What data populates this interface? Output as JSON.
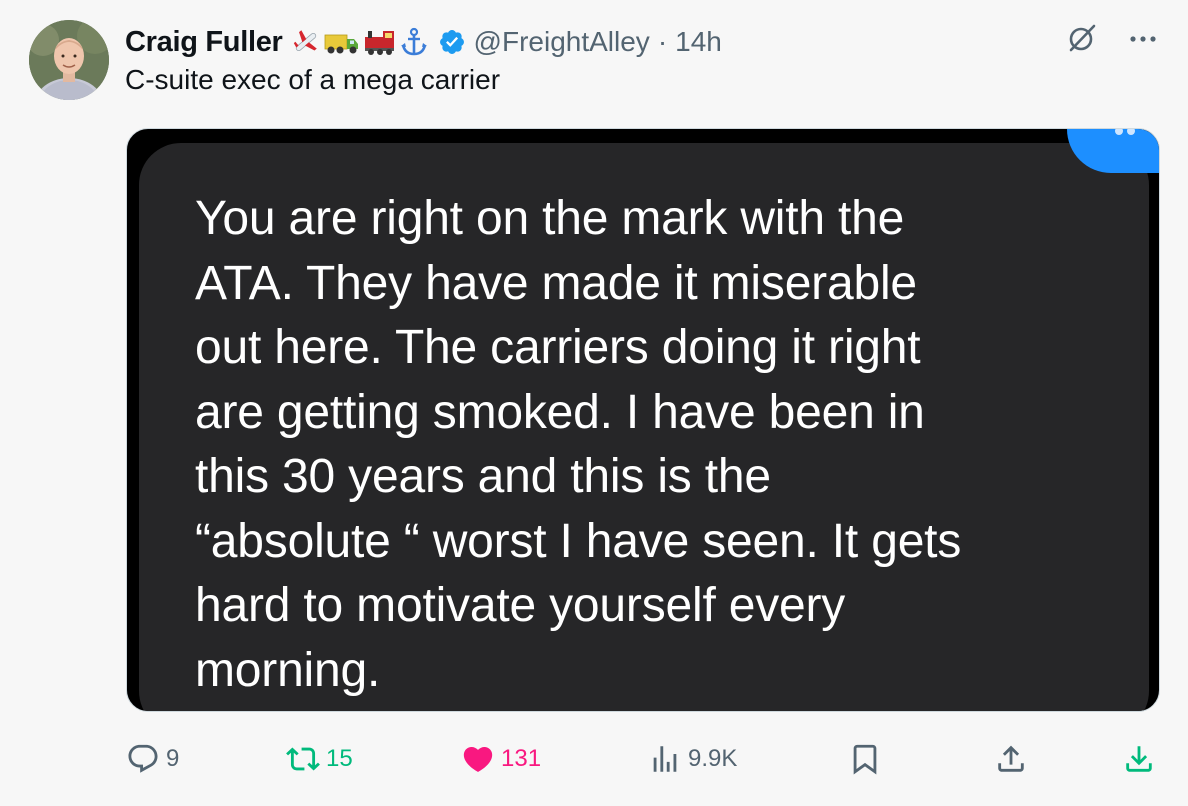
{
  "author": {
    "name": "Craig Fuller",
    "emojis": [
      "airplane-icon",
      "truck-icon",
      "train-icon",
      "anchor-icon"
    ],
    "handle": "@FreightAlley",
    "separator": "·",
    "time": "14h"
  },
  "bio": "C-suite exec of a mega carrier",
  "media": {
    "message_text": "You are right on the mark with the\nATA.  They have made it miserable\nout here. The carriers doing it right\nare getting smoked. I have been in\nthis 30 years and this is the\n“absolute “ worst I have seen. It gets\nhard to motivate yourself every\nmorning."
  },
  "actions": {
    "replies": "9",
    "reposts": "15",
    "likes": "131",
    "views": "9.9K"
  },
  "colors": {
    "accent": "#1d9bf0",
    "repost": "#00ba7c",
    "like": "#f91880",
    "muted": "#536471",
    "bubble": "#262628"
  }
}
